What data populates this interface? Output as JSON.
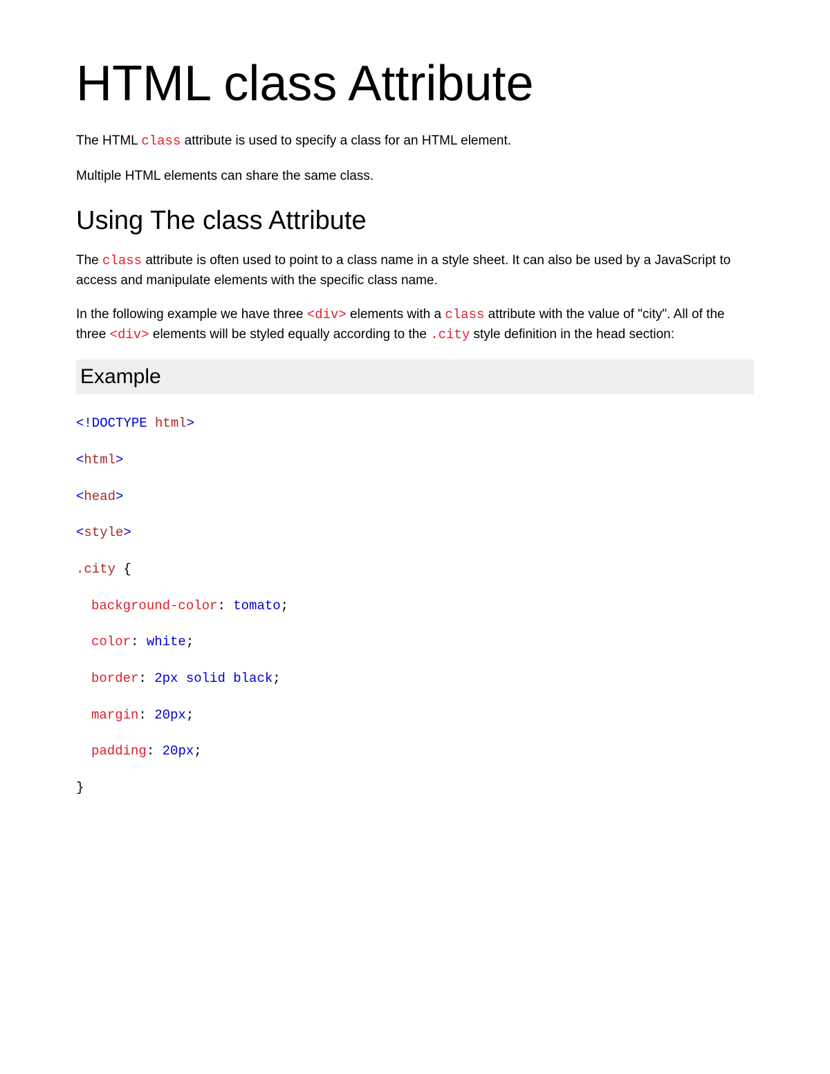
{
  "title": "HTML class Attribute",
  "intro": {
    "p1_a": "The HTML ",
    "p1_code": "class",
    "p1_b": " attribute is used to specify a class for an HTML element.",
    "p2": "Multiple HTML elements can share the same class."
  },
  "section1": {
    "heading": "Using The class Attribute",
    "p1_a": "The ",
    "p1_code": "class",
    "p1_b": " attribute is often used to point to a class name in a style sheet. It can also be used by a JavaScript to access and manipulate elements with the specific class name.",
    "p2_a": "In the following example we have three ",
    "p2_code1": "<div>",
    "p2_b": " elements with a ",
    "p2_code2": "class",
    "p2_c": " attribute with the value of \"city\". All of the three ",
    "p2_code3": "<div>",
    "p2_d": " elements will be styled equally according to the ",
    "p2_code4": ".city",
    "p2_e": " style definition in the head section:"
  },
  "example": {
    "label": "Example",
    "code": {
      "l1_a": "<!DOCTYPE",
      "l1_b": " html",
      "l1_c": ">",
      "l2_a": "<",
      "l2_b": "html",
      "l2_c": ">",
      "l3_a": "<",
      "l3_b": "head",
      "l3_c": ">",
      "l4_a": "<",
      "l4_b": "style",
      "l4_c": ">",
      "l5_a": ".city ",
      "l5_b": "{",
      "l6_a": "background-color",
      "l6_b": ":",
      "l6_c": " tomato",
      "l6_d": ";",
      "l7_a": "color",
      "l7_b": ":",
      "l7_c": " white",
      "l7_d": ";",
      "l8_a": "border",
      "l8_b": ":",
      "l8_c": " 2px solid black",
      "l8_d": ";",
      "l9_a": "margin",
      "l9_b": ":",
      "l9_c": " 20px",
      "l9_d": ";",
      "l10_a": "padding",
      "l10_b": ":",
      "l10_c": " 20px",
      "l10_d": ";",
      "l11": "}"
    }
  }
}
